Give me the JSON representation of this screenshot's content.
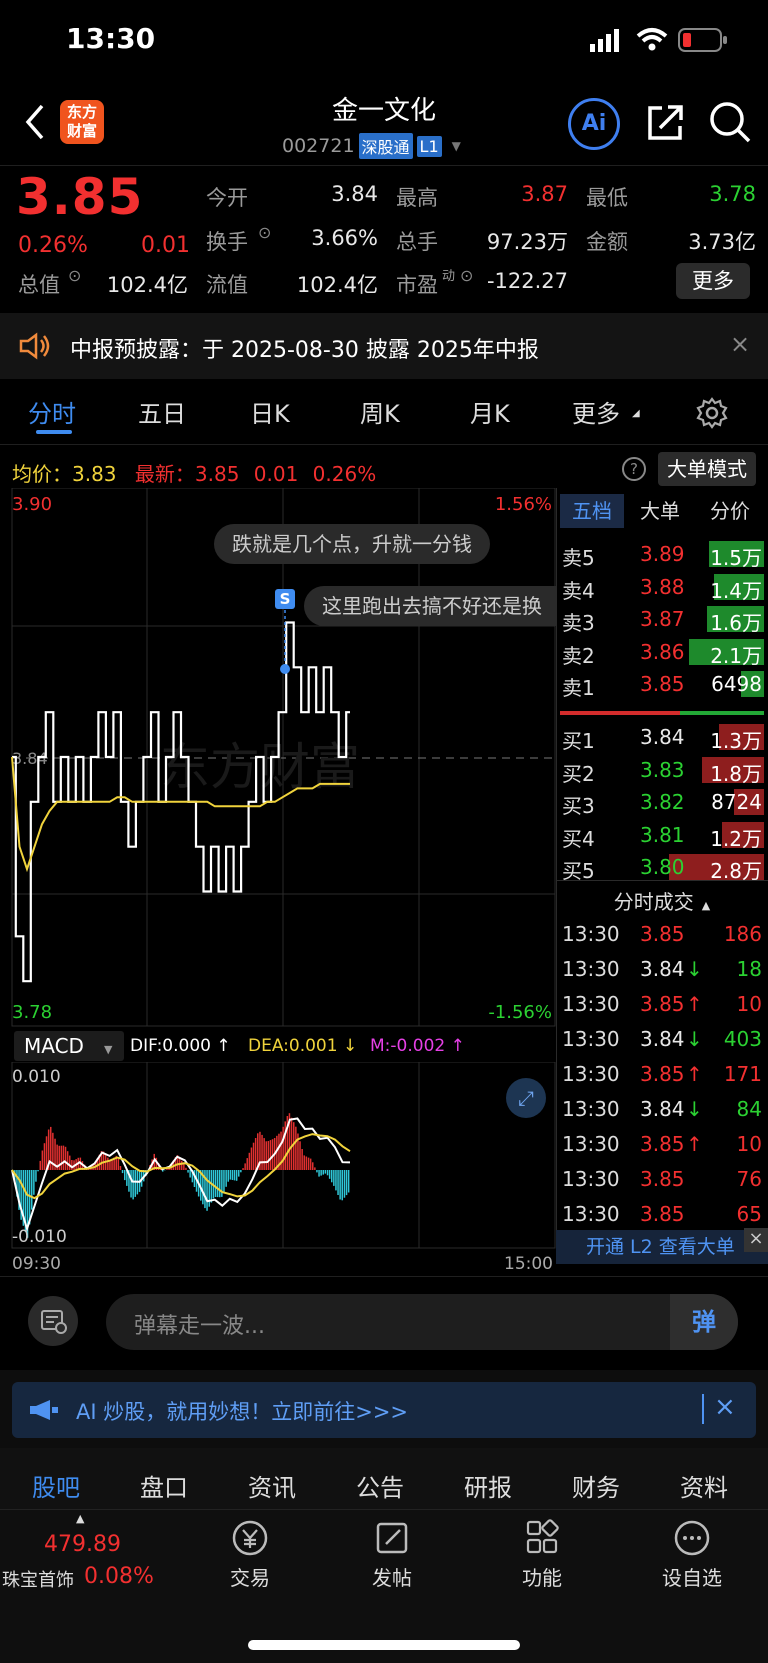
{
  "status_bar": {
    "time": "13:30"
  },
  "header": {
    "logo_line1": "东方",
    "logo_line2": "财富",
    "title": "金一文化",
    "code": "002721",
    "tag1": "深股通",
    "tag2": "L1",
    "ai_label": "Ai"
  },
  "quote": {
    "price": "3.85",
    "pct": "0.26%",
    "change": "0.01",
    "open_label": "今开",
    "open": "3.84",
    "high_label": "最高",
    "high": "3.87",
    "low_label": "最低",
    "low": "3.78",
    "turnover_label": "换手",
    "turnover": "3.66%",
    "vol_label": "总手",
    "vol": "97.23万",
    "amount_label": "金额",
    "amount": "3.73亿",
    "mcap_label": "总值",
    "mcap": "102.4亿",
    "float_label": "流值",
    "float": "102.4亿",
    "pe_label": "市盈",
    "pe_sup": "动",
    "pe": "-122.27",
    "more": "更多"
  },
  "notice": {
    "text": "中报预披露：于 2025-08-30 披露 2025年中报"
  },
  "chart_tabs": [
    "分时",
    "五日",
    "日K",
    "周K",
    "月K",
    "更多"
  ],
  "info_line": {
    "avg_label": "均价：",
    "avg": "3.83",
    "latest_label": "最新：",
    "latest": "3.85",
    "chg": "0.01",
    "pct": "0.26%",
    "mode": "大单模式"
  },
  "chart_labels": {
    "top": "3.90",
    "bottom": "3.78",
    "top_pct": "1.56%",
    "bottom_pct": "-1.56%",
    "mid": "3.84",
    "watermark": "东方财富",
    "time_start": "09:30",
    "time_end": "15:00"
  },
  "bullets": [
    "跌就是几个点，升就一分钱",
    "这里跑出去搞不好还是换"
  ],
  "s_marker": "S",
  "macd": {
    "label": "MACD",
    "dif": "DIF:0.000 ↑",
    "dea": "DEA:0.001 ↓",
    "m": "M:-0.002 ↑",
    "top": "0.010",
    "bottom": "-0.010"
  },
  "chart_data": {
    "type": "line",
    "ylim": [
      3.78,
      3.9
    ],
    "ref_price": 3.84,
    "price_series": [
      3.84,
      3.8,
      3.79,
      3.83,
      3.84,
      3.85,
      3.83,
      3.84,
      3.83,
      3.84,
      3.83,
      3.84,
      3.85,
      3.84,
      3.85,
      3.83,
      3.82,
      3.83,
      3.84,
      3.85,
      3.83,
      3.84,
      3.85,
      3.84,
      3.83,
      3.82,
      3.81,
      3.82,
      3.81,
      3.82,
      3.81,
      3.82,
      3.83,
      3.84,
      3.83,
      3.84,
      3.85,
      3.87,
      3.86,
      3.85,
      3.86,
      3.85,
      3.86,
      3.85,
      3.84,
      3.85
    ],
    "avg_series": [
      3.84,
      3.82,
      3.815,
      3.82,
      3.825,
      3.828,
      3.83,
      3.83,
      3.83,
      3.83,
      3.83,
      3.83,
      3.83,
      3.83,
      3.831,
      3.831,
      3.83,
      3.83,
      3.83,
      3.83,
      3.83,
      3.83,
      3.83,
      3.83,
      3.83,
      3.83,
      3.83,
      3.829,
      3.829,
      3.829,
      3.829,
      3.829,
      3.829,
      3.829,
      3.83,
      3.83,
      3.831,
      3.832,
      3.833,
      3.833,
      3.833,
      3.834,
      3.834,
      3.834,
      3.834,
      3.834
    ]
  },
  "order_book": {
    "tabs": [
      "五档",
      "大单",
      "分价"
    ],
    "asks": [
      {
        "label": "卖5",
        "price": "3.89",
        "vol": "1.5万",
        "fill": 0.55
      },
      {
        "label": "卖4",
        "price": "3.88",
        "vol": "1.4万",
        "fill": 0.5
      },
      {
        "label": "卖3",
        "price": "3.87",
        "vol": "1.6万",
        "fill": 0.57
      },
      {
        "label": "卖2",
        "price": "3.86",
        "vol": "2.1万",
        "fill": 0.75
      },
      {
        "label": "卖1",
        "price": "3.85",
        "vol": "6498",
        "fill": 0.23
      }
    ],
    "bids": [
      {
        "label": "买1",
        "price": "3.84",
        "vol": "1.3万",
        "fill": 0.45
      },
      {
        "label": "买2",
        "price": "3.83",
        "vol": "1.8万",
        "fill": 0.62
      },
      {
        "label": "买3",
        "price": "3.82",
        "vol": "8724",
        "fill": 0.3
      },
      {
        "label": "买4",
        "price": "3.81",
        "vol": "1.2万",
        "fill": 0.42
      },
      {
        "label": "买5",
        "price": "3.80",
        "vol": "2.8万",
        "fill": 0.95
      }
    ]
  },
  "ticks_title": "分时成交",
  "ticks": [
    {
      "t": "13:30",
      "p": "3.85",
      "a": "",
      "v": "186"
    },
    {
      "t": "13:30",
      "p": "3.84",
      "a": "↓",
      "v": "18"
    },
    {
      "t": "13:30",
      "p": "3.85",
      "a": "↑",
      "v": "10"
    },
    {
      "t": "13:30",
      "p": "3.84",
      "a": "↓",
      "v": "403"
    },
    {
      "t": "13:30",
      "p": "3.85",
      "a": "↑",
      "v": "171"
    },
    {
      "t": "13:30",
      "p": "3.84",
      "a": "↓",
      "v": "84"
    },
    {
      "t": "13:30",
      "p": "3.85",
      "a": "↑",
      "v": "10"
    },
    {
      "t": "13:30",
      "p": "3.85",
      "a": "",
      "v": "76"
    },
    {
      "t": "13:30",
      "p": "3.85",
      "a": "",
      "v": "65"
    }
  ],
  "l2_banner": "开通 L2 查看大单",
  "danmaku": {
    "placeholder": "弹幕走一波...",
    "btn": "弹"
  },
  "ad": {
    "text": "AI 炒股，就用妙想！立即前往>>>"
  },
  "bottom_tabs": [
    "股吧",
    "盘口",
    "资讯",
    "公告",
    "研报",
    "财务",
    "资料"
  ],
  "footer": {
    "index_value": "479.89",
    "index_name": "珠宝首饰",
    "index_pct": "0.08%",
    "items": [
      "交易",
      "发帖",
      "功能",
      "设自选"
    ]
  }
}
